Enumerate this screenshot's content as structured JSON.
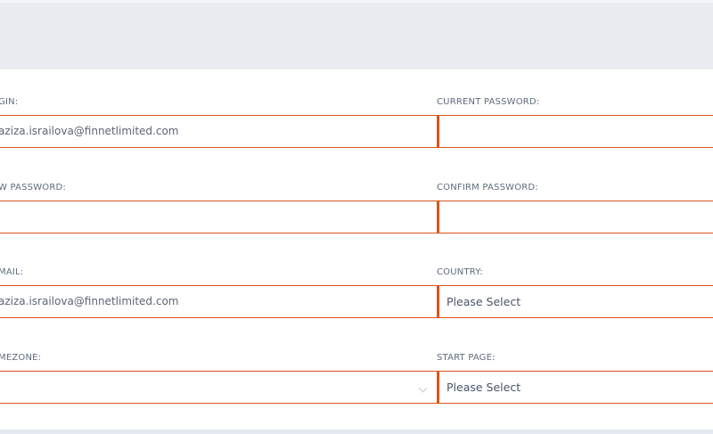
{
  "form": {
    "login": {
      "label": "GIN:",
      "value": "aziza.israilova@finnetlimited.com"
    },
    "current_password": {
      "label": "CURRENT PASSWORD:",
      "value": ""
    },
    "new_password": {
      "label": "W PASSWORD:",
      "value": ""
    },
    "confirm_password": {
      "label": "CONFIRM PASSWORD:",
      "value": ""
    },
    "email": {
      "label": "MAIL:",
      "value": "aziza.israilova@finnetlimited.com"
    },
    "country": {
      "label": "COUNTRY:",
      "value": "Please Select"
    },
    "timezone": {
      "label": "MEZONE:",
      "value": "",
      "icon": "chevron-down-icon"
    },
    "start_page": {
      "label": "START PAGE:",
      "value": "Please Select"
    }
  },
  "colors": {
    "field_border": "#d9541e",
    "header_bg": "#e9edf2",
    "label_text": "#5e6b7d"
  }
}
